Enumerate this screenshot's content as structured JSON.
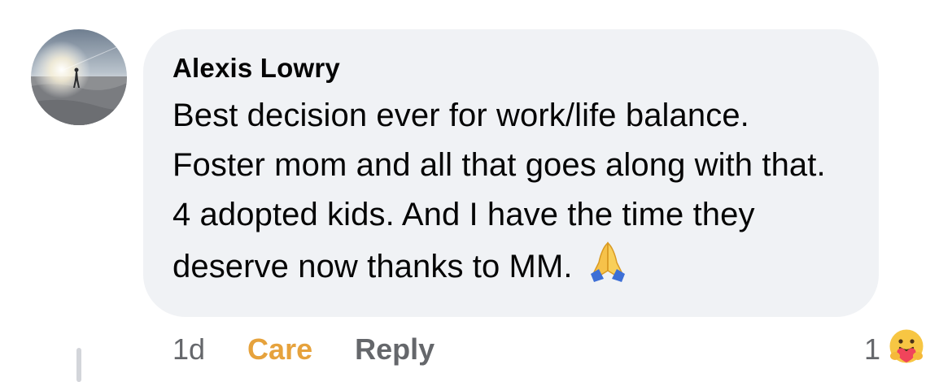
{
  "comment": {
    "author": "Alexis Lowry",
    "text": "Best decision ever for work/life balance. Foster mom and all that goes along with that. 4 adopted kids. And I have the time they deserve now thanks to MM.",
    "emoji_icon": "folded-hands-icon"
  },
  "actions": {
    "timestamp": "1d",
    "reaction_label": "Care",
    "reply_label": "Reply"
  },
  "reactions": {
    "count": "1",
    "icon": "care-reaction-icon"
  },
  "colors": {
    "bubble": "#f0f2f5",
    "care": "#e6a23c",
    "meta": "#65676b"
  }
}
